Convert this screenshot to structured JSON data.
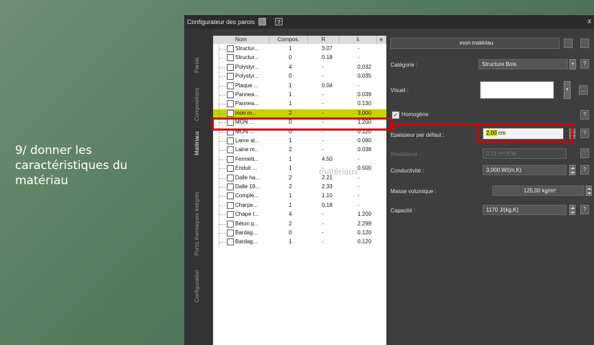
{
  "caption": "9/ donner les caractéristiques du matériau",
  "window": {
    "title": "Configurateur des parois",
    "help": "?",
    "close": "x"
  },
  "side_tabs": [
    "Parois",
    "Compositions",
    "Matériaux",
    "Ponts thermiques intégrés",
    "Configuration"
  ],
  "table": {
    "columns": [
      "Nom",
      "Compos.",
      "R",
      "λ",
      "e"
    ],
    "rows": [
      {
        "name": "Structur...",
        "compos": "1",
        "r": "3.07",
        "l": "-"
      },
      {
        "name": "Structur...",
        "compos": "0",
        "r": "0.18",
        "l": "-"
      },
      {
        "name": "Polystyr...",
        "compos": "4",
        "r": "-",
        "l": "0.032"
      },
      {
        "name": "Polystyr...",
        "compos": "0",
        "r": "-",
        "l": "0.035"
      },
      {
        "name": "Plaque ...",
        "compos": "1",
        "r": "0.04",
        "l": "-"
      },
      {
        "name": "Pannea...",
        "compos": "1",
        "r": "-",
        "l": "0.039"
      },
      {
        "name": "Pannea...",
        "compos": "1",
        "r": "-",
        "l": "0.130"
      },
      {
        "name": "mon m...",
        "compos": "2",
        "r": "-",
        "l": "3.000"
      },
      {
        "name": "MON ...",
        "compos": "0",
        "r": "-",
        "l": "1.200"
      },
      {
        "name": "MON ...",
        "compos": "0",
        "r": "-",
        "l": "0.120"
      },
      {
        "name": "Lame al...",
        "compos": "1",
        "r": "-",
        "l": "0.090"
      },
      {
        "name": "Laine m...",
        "compos": "2",
        "r": "-",
        "l": "0.038"
      },
      {
        "name": "Fermett...",
        "compos": "1",
        "r": "4.50",
        "l": "-"
      },
      {
        "name": "Enduit ...",
        "compos": "1",
        "r": "-",
        "l": "0.500"
      },
      {
        "name": "Dalle ha...",
        "compos": "2",
        "r": "2.21",
        "l": "-"
      },
      {
        "name": "Dalle 19...",
        "compos": "2",
        "r": "2.33",
        "l": "-"
      },
      {
        "name": "Comple...",
        "compos": "1",
        "r": "1.10",
        "l": "-"
      },
      {
        "name": "Charpe...",
        "compos": "1",
        "r": "0.18",
        "l": "-"
      },
      {
        "name": "Chape t...",
        "compos": "4",
        "r": "-",
        "l": "1.200"
      },
      {
        "name": "Béton p...",
        "compos": "2",
        "r": "-",
        "l": "2.299"
      },
      {
        "name": "Bardag...",
        "compos": "0",
        "r": "-",
        "l": "0.120"
      },
      {
        "name": "Bardag...",
        "compos": "1",
        "r": "-",
        "l": "0.120"
      }
    ]
  },
  "material": {
    "name": "mon matériau",
    "categorie_label": "Catégorie :",
    "categorie_value": "Structure Bois",
    "visuel_label": "Visuel :",
    "visuel_button": "...",
    "homogene_label": "Homogène",
    "epaisseur_label": "Epaisseur par défaut :",
    "epaisseur_value": "2,00",
    "epaisseur_unit": "cm",
    "resistance_label": "Résistance :",
    "resistance_value": "0,01 m².K/W",
    "conductivite_label": "Conductivité :",
    "conductivite_value": "3,000 W/(m.K)",
    "masse_label": "Masse volumique :",
    "masse_value": "125,00 kg/m³",
    "capacite_label": "Capacité :",
    "capacite_value": "1170 J/(kg.K)",
    "tooltip": "matériaux"
  }
}
